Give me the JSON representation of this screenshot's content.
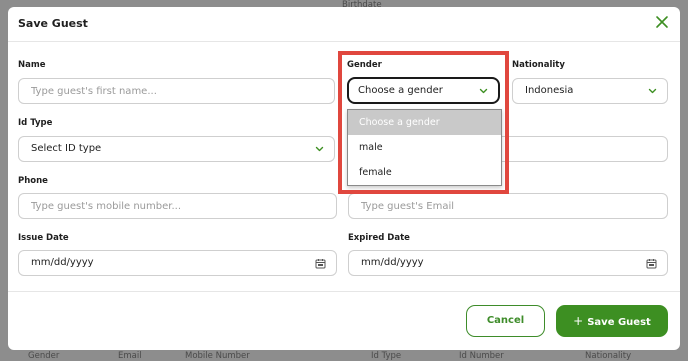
{
  "background": {
    "header_text": "Birthdate",
    "columns": [
      "Gender",
      "Email",
      "Mobile Number",
      "Id Type",
      "Id Number",
      "Nationality"
    ]
  },
  "modal": {
    "title": "Save Guest",
    "close_icon": "close-icon",
    "name": {
      "label": "Name",
      "placeholder": "Type guest's first name..."
    },
    "gender": {
      "label": "Gender",
      "value": "Choose a gender",
      "options": [
        "Choose a gender",
        "male",
        "female"
      ]
    },
    "nationality": {
      "label": "Nationality",
      "value": "Indonesia"
    },
    "id_type": {
      "label": "Id Type",
      "value": "Select ID type"
    },
    "phone": {
      "label": "Phone",
      "placeholder": "Type guest's mobile number..."
    },
    "email": {
      "placeholder": "Type guest's Email"
    },
    "issue_date": {
      "label": "Issue Date",
      "value": "mm/dd/yyyy"
    },
    "expired_date": {
      "label": "Expired Date",
      "value": "mm/dd/yyyy"
    },
    "buttons": {
      "cancel": "Cancel",
      "save": "Save Guest",
      "save_icon": "plus-icon"
    }
  },
  "colors": {
    "accent": "#3d8f22",
    "highlight": "#e0473e",
    "overlay": "#8d8d8d"
  }
}
